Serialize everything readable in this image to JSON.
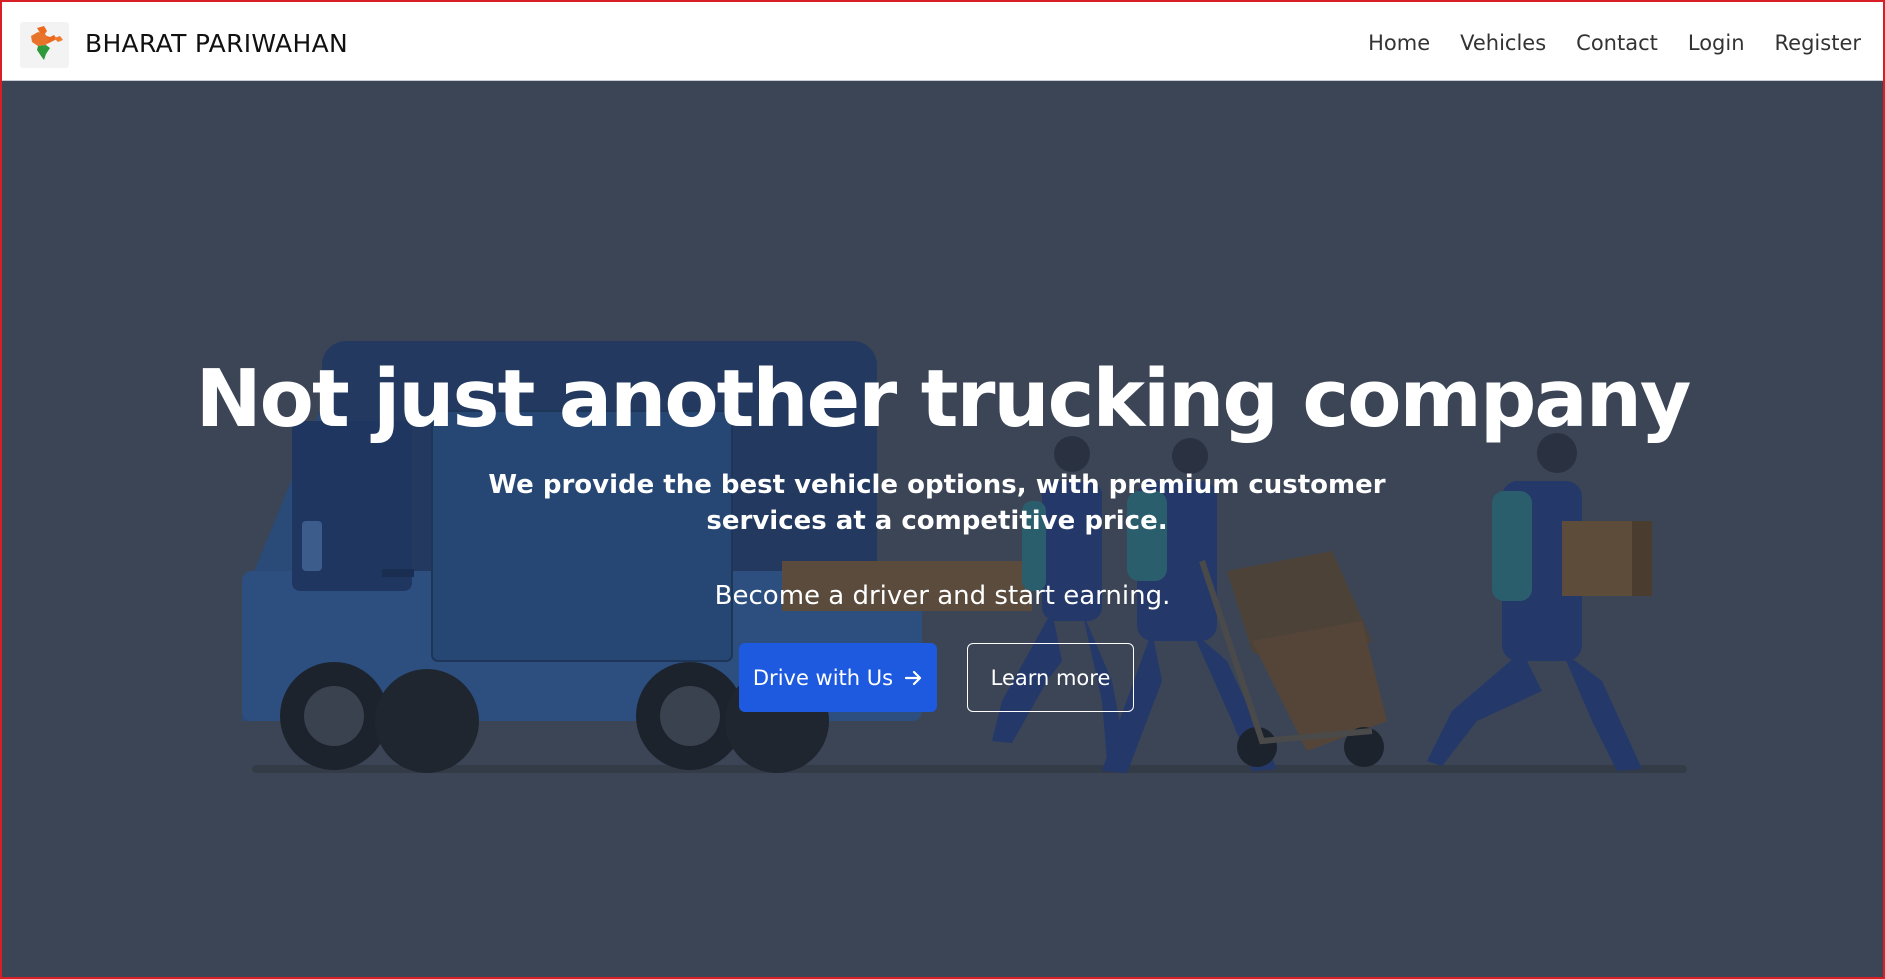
{
  "navbar": {
    "brand": "BHARAT PARIWAHAN",
    "logo_icon": "india-map-logo-icon",
    "links": [
      "Home",
      "Vehicles",
      "Contact",
      "Login",
      "Register"
    ]
  },
  "hero": {
    "title": "Not just another trucking company",
    "subtitle": "We provide the best vehicle options, with premium customer services at a competitive price.",
    "cta_text": "Become a driver and start earning.",
    "primary_button": "Drive with Us",
    "primary_button_icon": "arrow-right-icon",
    "secondary_button": "Learn more"
  },
  "colors": {
    "frame_border": "#d81f26",
    "hero_overlay": "#3b4556",
    "primary_button": "#1d5ae0"
  }
}
